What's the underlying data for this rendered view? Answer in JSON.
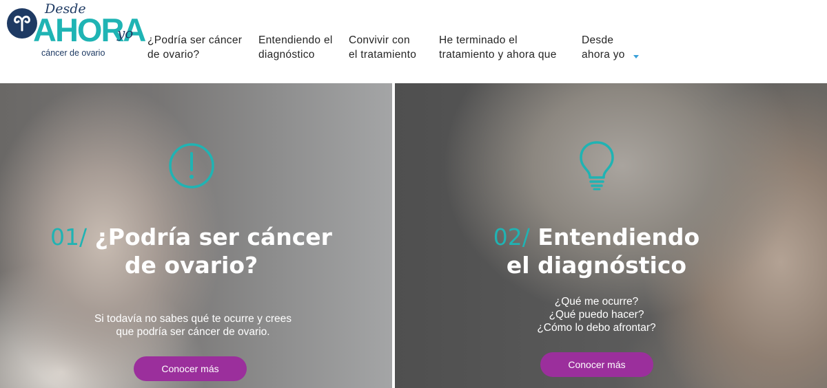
{
  "logo": {
    "desde": "Desde",
    "ahora": "AHORA",
    "yo": "yo",
    "subtitle": "cáncer de ovario"
  },
  "nav": {
    "items": [
      {
        "lines": [
          "¿Podría ser cáncer",
          "de ovario?"
        ]
      },
      {
        "lines": [
          "Entendiendo el",
          "diagnóstico"
        ]
      },
      {
        "lines": [
          "Convivir con",
          "el tratamiento"
        ]
      },
      {
        "lines": [
          "He terminado el",
          "tratamiento y ahora que"
        ]
      },
      {
        "lines": [
          "Desde",
          "ahora yo"
        ],
        "has_dropdown": true
      }
    ]
  },
  "panels": [
    {
      "icon": "exclamation-circle-icon",
      "number": "01/",
      "title_line1": "¿Podría ser cáncer",
      "title_line2": "de ovario?",
      "description": [
        "Si todavía no sabes qué te ocurre y crees",
        "que podría ser cáncer de ovario."
      ],
      "button_label": "Conocer más"
    },
    {
      "icon": "lightbulb-icon",
      "number": "02/",
      "title_line1": "Entendiendo",
      "title_line2": "el diagnóstico",
      "description": [
        "¿Qué me ocurre?",
        "¿Qué puedo hacer?",
        "¿Cómo lo debo afrontar?"
      ],
      "button_label": "Conocer más"
    }
  ],
  "colors": {
    "teal": "#20b3b3",
    "navy": "#1e3a63",
    "button_purple": "#9b2f9c",
    "dropdown_caret": "#3aa0d8"
  }
}
